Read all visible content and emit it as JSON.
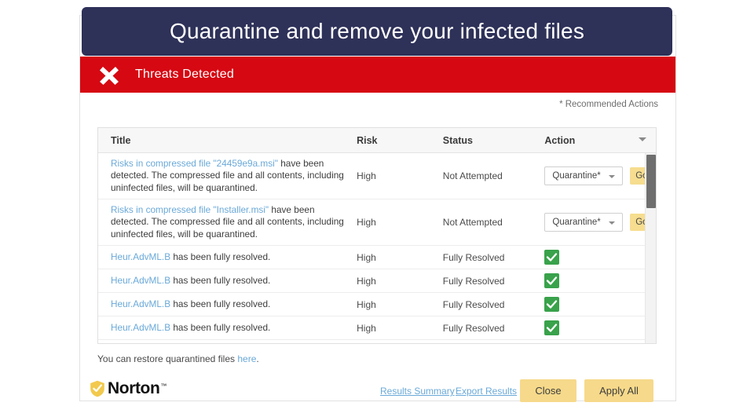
{
  "banner": {
    "text": "Quarantine and remove your infected files",
    "background": "#2e3158",
    "text_color": "#ffffff"
  },
  "window": {
    "titlebar": {
      "icon": "x-icon",
      "title": "Threats Detected",
      "background": "#d60812"
    },
    "recommended_note": "* Recommended Actions"
  },
  "table": {
    "columns": [
      "Title",
      "Risk",
      "Status",
      "Action"
    ],
    "header_chevron_icon": "chevron-down-icon",
    "rows": [
      {
        "title_link": "Risks in compressed file \"24459e9a.msi\"",
        "title_rest": " have been detected. The compressed file and all contents, including uninfected files, will be quarantined.",
        "risk": "High",
        "status": "Not Attempted",
        "action_type": "select",
        "action_value": "Quarantine*",
        "action_button": "Go"
      },
      {
        "title_link": "Risks in compressed file \"Installer.msi\"",
        "title_rest": " have been detected. The compressed file and all contents, including uninfected files, will be quarantined.",
        "risk": "High",
        "status": "Not Attempted",
        "action_type": "select",
        "action_value": "Quarantine*",
        "action_button": "Go"
      },
      {
        "title_link": "Heur.AdvML.B",
        "title_rest": " has been fully resolved.",
        "risk": "High",
        "status": "Fully Resolved",
        "action_type": "check",
        "action_value": "resolved-check-icon"
      },
      {
        "title_link": "Heur.AdvML.B",
        "title_rest": " has been fully resolved.",
        "risk": "High",
        "status": "Fully Resolved",
        "action_type": "check",
        "action_value": "resolved-check-icon"
      },
      {
        "title_link": "Heur.AdvML.B",
        "title_rest": " has been fully resolved.",
        "risk": "High",
        "status": "Fully Resolved",
        "action_type": "check",
        "action_value": "resolved-check-icon"
      },
      {
        "title_link": "Heur.AdvML.B",
        "title_rest": " has been fully resolved.",
        "risk": "High",
        "status": "Fully Resolved",
        "action_type": "check",
        "action_value": "resolved-check-icon"
      }
    ],
    "scrollbar": {
      "thumb_color": "#6e6e6e",
      "track_color": "#f3f3f3"
    }
  },
  "restore": {
    "text_before": "You can restore quarantined files ",
    "link": "here",
    "text_after": "."
  },
  "footer": {
    "logo_text": "Norton",
    "logo_tm": "™",
    "logo_icon": "norton-shield-check-icon",
    "links": [
      {
        "label": "Results Summary"
      },
      {
        "label": "Export Results"
      }
    ],
    "buttons": [
      {
        "label": "Close"
      },
      {
        "label": "Apply All"
      }
    ]
  },
  "colors": {
    "accent_red": "#d60812",
    "banner_navy": "#2e3158",
    "button_amber": "#f6d98a",
    "link_blue": "#6aa9d8",
    "success_green": "#39a24b"
  }
}
